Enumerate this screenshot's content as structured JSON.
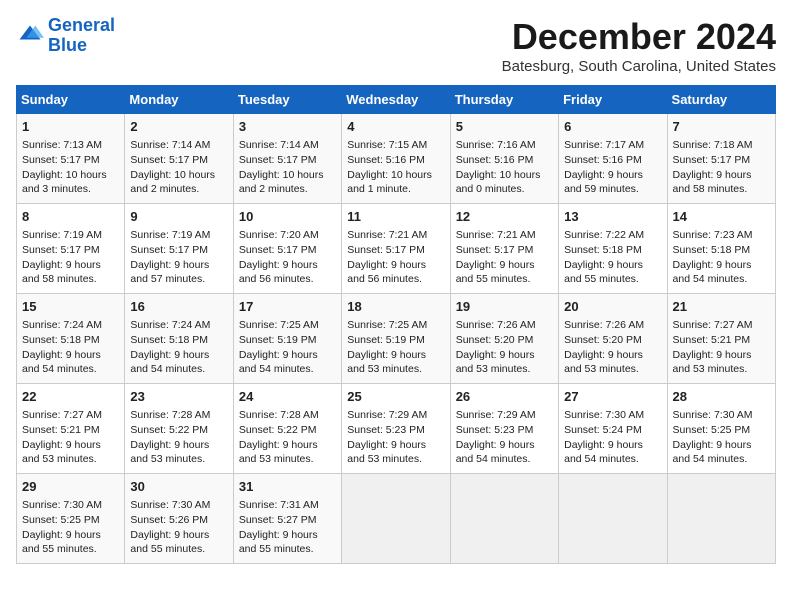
{
  "logo": {
    "line1": "General",
    "line2": "Blue"
  },
  "title": "December 2024",
  "location": "Batesburg, South Carolina, United States",
  "days_of_week": [
    "Sunday",
    "Monday",
    "Tuesday",
    "Wednesday",
    "Thursday",
    "Friday",
    "Saturday"
  ],
  "weeks": [
    [
      {
        "day": "1",
        "content": "Sunrise: 7:13 AM\nSunset: 5:17 PM\nDaylight: 10 hours\nand 3 minutes."
      },
      {
        "day": "2",
        "content": "Sunrise: 7:14 AM\nSunset: 5:17 PM\nDaylight: 10 hours\nand 2 minutes."
      },
      {
        "day": "3",
        "content": "Sunrise: 7:14 AM\nSunset: 5:17 PM\nDaylight: 10 hours\nand 2 minutes."
      },
      {
        "day": "4",
        "content": "Sunrise: 7:15 AM\nSunset: 5:16 PM\nDaylight: 10 hours\nand 1 minute."
      },
      {
        "day": "5",
        "content": "Sunrise: 7:16 AM\nSunset: 5:16 PM\nDaylight: 10 hours\nand 0 minutes."
      },
      {
        "day": "6",
        "content": "Sunrise: 7:17 AM\nSunset: 5:16 PM\nDaylight: 9 hours\nand 59 minutes."
      },
      {
        "day": "7",
        "content": "Sunrise: 7:18 AM\nSunset: 5:17 PM\nDaylight: 9 hours\nand 58 minutes."
      }
    ],
    [
      {
        "day": "8",
        "content": "Sunrise: 7:19 AM\nSunset: 5:17 PM\nDaylight: 9 hours\nand 58 minutes."
      },
      {
        "day": "9",
        "content": "Sunrise: 7:19 AM\nSunset: 5:17 PM\nDaylight: 9 hours\nand 57 minutes."
      },
      {
        "day": "10",
        "content": "Sunrise: 7:20 AM\nSunset: 5:17 PM\nDaylight: 9 hours\nand 56 minutes."
      },
      {
        "day": "11",
        "content": "Sunrise: 7:21 AM\nSunset: 5:17 PM\nDaylight: 9 hours\nand 56 minutes."
      },
      {
        "day": "12",
        "content": "Sunrise: 7:21 AM\nSunset: 5:17 PM\nDaylight: 9 hours\nand 55 minutes."
      },
      {
        "day": "13",
        "content": "Sunrise: 7:22 AM\nSunset: 5:18 PM\nDaylight: 9 hours\nand 55 minutes."
      },
      {
        "day": "14",
        "content": "Sunrise: 7:23 AM\nSunset: 5:18 PM\nDaylight: 9 hours\nand 54 minutes."
      }
    ],
    [
      {
        "day": "15",
        "content": "Sunrise: 7:24 AM\nSunset: 5:18 PM\nDaylight: 9 hours\nand 54 minutes."
      },
      {
        "day": "16",
        "content": "Sunrise: 7:24 AM\nSunset: 5:18 PM\nDaylight: 9 hours\nand 54 minutes."
      },
      {
        "day": "17",
        "content": "Sunrise: 7:25 AM\nSunset: 5:19 PM\nDaylight: 9 hours\nand 54 minutes."
      },
      {
        "day": "18",
        "content": "Sunrise: 7:25 AM\nSunset: 5:19 PM\nDaylight: 9 hours\nand 53 minutes."
      },
      {
        "day": "19",
        "content": "Sunrise: 7:26 AM\nSunset: 5:20 PM\nDaylight: 9 hours\nand 53 minutes."
      },
      {
        "day": "20",
        "content": "Sunrise: 7:26 AM\nSunset: 5:20 PM\nDaylight: 9 hours\nand 53 minutes."
      },
      {
        "day": "21",
        "content": "Sunrise: 7:27 AM\nSunset: 5:21 PM\nDaylight: 9 hours\nand 53 minutes."
      }
    ],
    [
      {
        "day": "22",
        "content": "Sunrise: 7:27 AM\nSunset: 5:21 PM\nDaylight: 9 hours\nand 53 minutes."
      },
      {
        "day": "23",
        "content": "Sunrise: 7:28 AM\nSunset: 5:22 PM\nDaylight: 9 hours\nand 53 minutes."
      },
      {
        "day": "24",
        "content": "Sunrise: 7:28 AM\nSunset: 5:22 PM\nDaylight: 9 hours\nand 53 minutes."
      },
      {
        "day": "25",
        "content": "Sunrise: 7:29 AM\nSunset: 5:23 PM\nDaylight: 9 hours\nand 53 minutes."
      },
      {
        "day": "26",
        "content": "Sunrise: 7:29 AM\nSunset: 5:23 PM\nDaylight: 9 hours\nand 54 minutes."
      },
      {
        "day": "27",
        "content": "Sunrise: 7:30 AM\nSunset: 5:24 PM\nDaylight: 9 hours\nand 54 minutes."
      },
      {
        "day": "28",
        "content": "Sunrise: 7:30 AM\nSunset: 5:25 PM\nDaylight: 9 hours\nand 54 minutes."
      }
    ],
    [
      {
        "day": "29",
        "content": "Sunrise: 7:30 AM\nSunset: 5:25 PM\nDaylight: 9 hours\nand 55 minutes."
      },
      {
        "day": "30",
        "content": "Sunrise: 7:30 AM\nSunset: 5:26 PM\nDaylight: 9 hours\nand 55 minutes."
      },
      {
        "day": "31",
        "content": "Sunrise: 7:31 AM\nSunset: 5:27 PM\nDaylight: 9 hours\nand 55 minutes."
      },
      {
        "day": "",
        "content": ""
      },
      {
        "day": "",
        "content": ""
      },
      {
        "day": "",
        "content": ""
      },
      {
        "day": "",
        "content": ""
      }
    ]
  ]
}
